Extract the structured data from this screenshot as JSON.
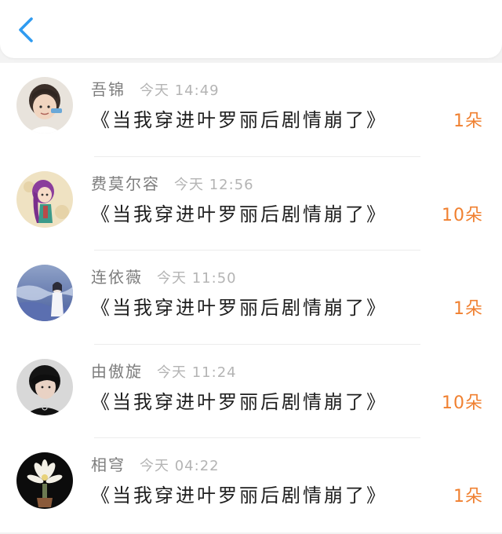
{
  "header": {
    "back_icon": "chevron-left-icon",
    "accent_color": "#2f9bf0"
  },
  "rows": [
    {
      "name": "吾锦",
      "time": "今天 14:49",
      "title": "《当我穿进叶罗丽后剧情崩了》",
      "count": "1朵",
      "avatar": "avatar-photo-boy"
    },
    {
      "name": "费莫尔容",
      "time": "今天 12:56",
      "title": "《当我穿进叶罗丽后剧情崩了》",
      "count": "10朵",
      "avatar": "avatar-illustration-purple-hair"
    },
    {
      "name": "连依薇",
      "time": "今天 11:50",
      "title": "《当我穿进叶罗丽后剧情崩了》",
      "count": "1朵",
      "avatar": "avatar-photo-sea"
    },
    {
      "name": "由傲旋",
      "time": "今天 11:24",
      "title": "《当我穿进叶罗丽后剧情崩了》",
      "count": "10朵",
      "avatar": "avatar-photo-dark-hair"
    },
    {
      "name": "相穹",
      "time": "今天 04:22",
      "title": "《当我穿进叶罗丽后剧情崩了》",
      "count": "1朵",
      "avatar": "avatar-photo-flower"
    }
  ],
  "colors": {
    "count": "#f08030",
    "name": "#7d7d7d",
    "time": "#b4b4b4",
    "title": "#1e1e1e"
  }
}
